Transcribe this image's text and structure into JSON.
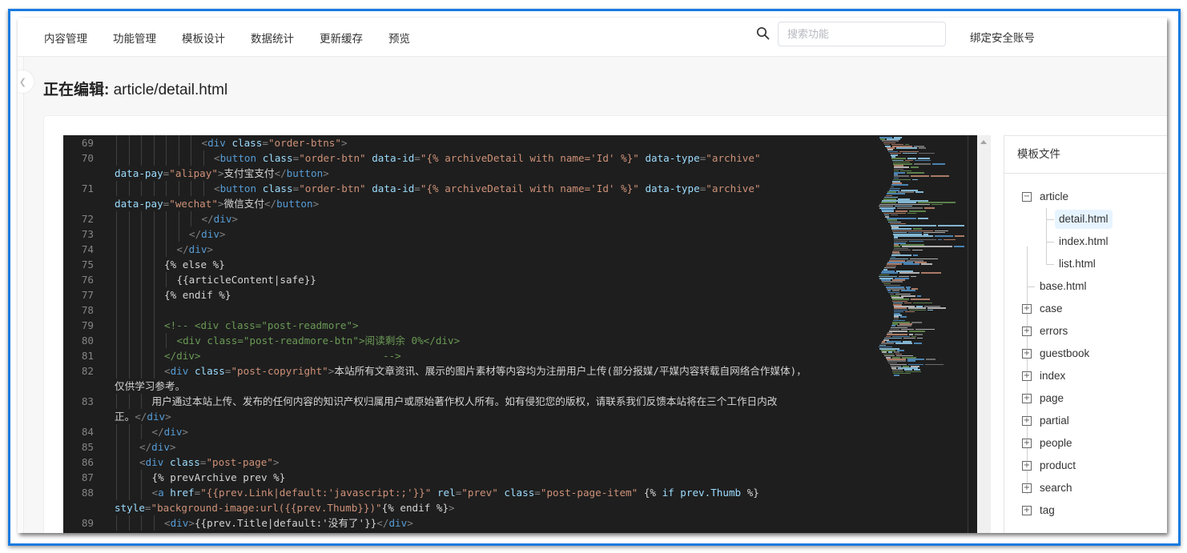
{
  "nav": {
    "items": [
      "内容管理",
      "功能管理",
      "模板设计",
      "数据统计",
      "更新缓存",
      "预览"
    ],
    "search_icon": "search-icon",
    "search_placeholder": "搜索功能",
    "search_value": "",
    "bind_account": "绑定安全账号"
  },
  "page": {
    "title_prefix": "正在编辑:",
    "title_file": " article/detail.html",
    "collapse_icon": "chevron-left-icon"
  },
  "editor": {
    "lines": [
      {
        "n": "69",
        "indent": 7,
        "tokens": [
          [
            "br",
            "<"
          ],
          [
            "tag",
            "div"
          ],
          [
            "cn",
            " "
          ],
          [
            "attr",
            "class"
          ],
          [
            "br",
            "="
          ],
          [
            "str",
            "\"order-btns\""
          ],
          [
            "br",
            ">"
          ]
        ]
      },
      {
        "n": "70",
        "indent": 8,
        "tokens": [
          [
            "br",
            "<"
          ],
          [
            "tag",
            "button"
          ],
          [
            "cn",
            " "
          ],
          [
            "attr",
            "class"
          ],
          [
            "br",
            "="
          ],
          [
            "str",
            "\"order-btn\""
          ],
          [
            "cn",
            " "
          ],
          [
            "attr",
            "data-id"
          ],
          [
            "br",
            "="
          ],
          [
            "str",
            "\"{% archiveDetail with name='Id' %}\""
          ],
          [
            "cn",
            " "
          ],
          [
            "attr",
            "data-type"
          ],
          [
            "br",
            "="
          ],
          [
            "str",
            "\"archive\""
          ]
        ],
        "wrap": [
          [
            "attr",
            "data-pay"
          ],
          [
            "br",
            "="
          ],
          [
            "str",
            "\"alipay\""
          ],
          [
            "br",
            ">"
          ],
          [
            "cn",
            "支付宝支付"
          ],
          [
            "br",
            "</"
          ],
          [
            "tag",
            "button"
          ],
          [
            "br",
            ">"
          ]
        ]
      },
      {
        "n": "71",
        "indent": 8,
        "tokens": [
          [
            "br",
            "<"
          ],
          [
            "tag",
            "button"
          ],
          [
            "cn",
            " "
          ],
          [
            "attr",
            "class"
          ],
          [
            "br",
            "="
          ],
          [
            "str",
            "\"order-btn\""
          ],
          [
            "cn",
            " "
          ],
          [
            "attr",
            "data-id"
          ],
          [
            "br",
            "="
          ],
          [
            "str",
            "\"{% archiveDetail with name='Id' %}\""
          ],
          [
            "cn",
            " "
          ],
          [
            "attr",
            "data-type"
          ],
          [
            "br",
            "="
          ],
          [
            "str",
            "\"archive\""
          ]
        ],
        "wrap": [
          [
            "attr",
            "data-pay"
          ],
          [
            "br",
            "="
          ],
          [
            "str",
            "\"wechat\""
          ],
          [
            "br",
            ">"
          ],
          [
            "cn",
            "微信支付"
          ],
          [
            "br",
            "</"
          ],
          [
            "tag",
            "button"
          ],
          [
            "br",
            ">"
          ]
        ]
      },
      {
        "n": "72",
        "indent": 7,
        "tokens": [
          [
            "br",
            "</"
          ],
          [
            "tag",
            "div"
          ],
          [
            "br",
            ">"
          ]
        ]
      },
      {
        "n": "73",
        "indent": 6,
        "tokens": [
          [
            "br",
            "</"
          ],
          [
            "tag",
            "div"
          ],
          [
            "br",
            ">"
          ]
        ]
      },
      {
        "n": "74",
        "indent": 5,
        "tokens": [
          [
            "br",
            "</"
          ],
          [
            "tag",
            "div"
          ],
          [
            "br",
            ">"
          ]
        ]
      },
      {
        "n": "75",
        "indent": 4,
        "tokens": [
          [
            "cn",
            "{% else %}"
          ]
        ]
      },
      {
        "n": "76",
        "indent": 5,
        "tokens": [
          [
            "cn",
            "{{articleContent|safe}}"
          ]
        ]
      },
      {
        "n": "77",
        "indent": 4,
        "tokens": [
          [
            "cn",
            "{% endif %}"
          ]
        ]
      },
      {
        "n": "78",
        "indent": 4,
        "tokens": []
      },
      {
        "n": "79",
        "indent": 4,
        "tokens": [
          [
            "cm",
            "<!-- <div class=\"post-readmore\">"
          ]
        ]
      },
      {
        "n": "80",
        "indent": 5,
        "tokens": [
          [
            "cm",
            "<div class=\"post-readmore-btn\">阅读剩余 0%</div>"
          ]
        ]
      },
      {
        "n": "81",
        "indent": 4,
        "tokens": [
          [
            "cm",
            "</div>                              -->"
          ]
        ]
      },
      {
        "n": "82",
        "indent": 4,
        "tokens": [
          [
            "br",
            "<"
          ],
          [
            "tag",
            "div"
          ],
          [
            "cn",
            " "
          ],
          [
            "attr",
            "class"
          ],
          [
            "br",
            "="
          ],
          [
            "str",
            "\"post-copyright\""
          ],
          [
            "br",
            ">"
          ],
          [
            "cn",
            "本站所有文章资讯、展示的图片素材等内容均为注册用户上传(部分报媒/平媒内容转载自网络合作媒体)，"
          ]
        ],
        "wrap": [
          [
            "cn",
            "仅供学习参考。"
          ]
        ]
      },
      {
        "n": "83",
        "indent": 3,
        "tokens": [
          [
            "cn",
            "用户通过本站上传、发布的任何内容的知识产权归属用户或原始著作权人所有。如有侵犯您的版权，请联系我们反馈本站将在三个工作日内改"
          ]
        ],
        "wrap": [
          [
            "cn",
            "正。"
          ],
          [
            "br",
            "</"
          ],
          [
            "tag",
            "div"
          ],
          [
            "br",
            ">"
          ]
        ]
      },
      {
        "n": "84",
        "indent": 3,
        "tokens": [
          [
            "br",
            "</"
          ],
          [
            "tag",
            "div"
          ],
          [
            "br",
            ">"
          ]
        ]
      },
      {
        "n": "85",
        "indent": 2,
        "tokens": [
          [
            "br",
            "</"
          ],
          [
            "tag",
            "div"
          ],
          [
            "br",
            ">"
          ]
        ]
      },
      {
        "n": "86",
        "indent": 2,
        "tokens": [
          [
            "br",
            "<"
          ],
          [
            "tag",
            "div"
          ],
          [
            "cn",
            " "
          ],
          [
            "attr",
            "class"
          ],
          [
            "br",
            "="
          ],
          [
            "str",
            "\"post-page\""
          ],
          [
            "br",
            ">"
          ]
        ]
      },
      {
        "n": "87",
        "indent": 3,
        "tokens": [
          [
            "cn",
            "{% prevArchive prev %}"
          ]
        ]
      },
      {
        "n": "88",
        "indent": 3,
        "tokens": [
          [
            "br",
            "<"
          ],
          [
            "tag",
            "a"
          ],
          [
            "cn",
            " "
          ],
          [
            "attr",
            "href"
          ],
          [
            "br",
            "="
          ],
          [
            "str",
            "\"{{prev.Link|default:'javascript:;'}}\""
          ],
          [
            "cn",
            " "
          ],
          [
            "attr",
            "rel"
          ],
          [
            "br",
            "="
          ],
          [
            "str",
            "\"prev\""
          ],
          [
            "cn",
            " "
          ],
          [
            "attr",
            "class"
          ],
          [
            "br",
            "="
          ],
          [
            "str",
            "\"post-page-item\""
          ],
          [
            "cn",
            " "
          ],
          [
            "cn",
            "{% "
          ],
          [
            "attr",
            "if prev.Thumb"
          ],
          [
            "cn",
            " %}"
          ]
        ],
        "wrap": [
          [
            "attr",
            "style"
          ],
          [
            "br",
            "="
          ],
          [
            "str",
            "\"background-image:url({{prev.Thumb}})\""
          ],
          [
            "cn",
            "{% endif %}"
          ],
          [
            "br",
            ">"
          ]
        ]
      },
      {
        "n": "89",
        "indent": 4,
        "tokens": [
          [
            "br",
            "<"
          ],
          [
            "tag",
            "div"
          ],
          [
            "br",
            ">"
          ],
          [
            "cn",
            "{{prev.Title|default:'没有了'}}"
          ],
          [
            "br",
            "</"
          ],
          [
            "tag",
            "div"
          ],
          [
            "br",
            ">"
          ]
        ]
      }
    ],
    "minimap_label": "code-minimap",
    "scroll_up_icon": "scroll-up-arrow-icon"
  },
  "tree": {
    "title": "模板文件",
    "nodes": [
      {
        "label": "article",
        "level": 0,
        "toggle": "−",
        "expanded": true
      },
      {
        "label": "detail.html",
        "level": 1,
        "selected": true
      },
      {
        "label": "index.html",
        "level": 1
      },
      {
        "label": "list.html",
        "level": 1
      },
      {
        "label": "base.html",
        "level": 0
      },
      {
        "label": "case",
        "level": 0,
        "toggle": "+"
      },
      {
        "label": "errors",
        "level": 0,
        "toggle": "+"
      },
      {
        "label": "guestbook",
        "level": 0,
        "toggle": "+"
      },
      {
        "label": "index",
        "level": 0,
        "toggle": "+"
      },
      {
        "label": "page",
        "level": 0,
        "toggle": "+"
      },
      {
        "label": "partial",
        "level": 0,
        "toggle": "+"
      },
      {
        "label": "people",
        "level": 0,
        "toggle": "+"
      },
      {
        "label": "product",
        "level": 0,
        "toggle": "+"
      },
      {
        "label": "search",
        "level": 0,
        "toggle": "+"
      },
      {
        "label": "tag",
        "level": 0,
        "toggle": "+"
      }
    ]
  }
}
